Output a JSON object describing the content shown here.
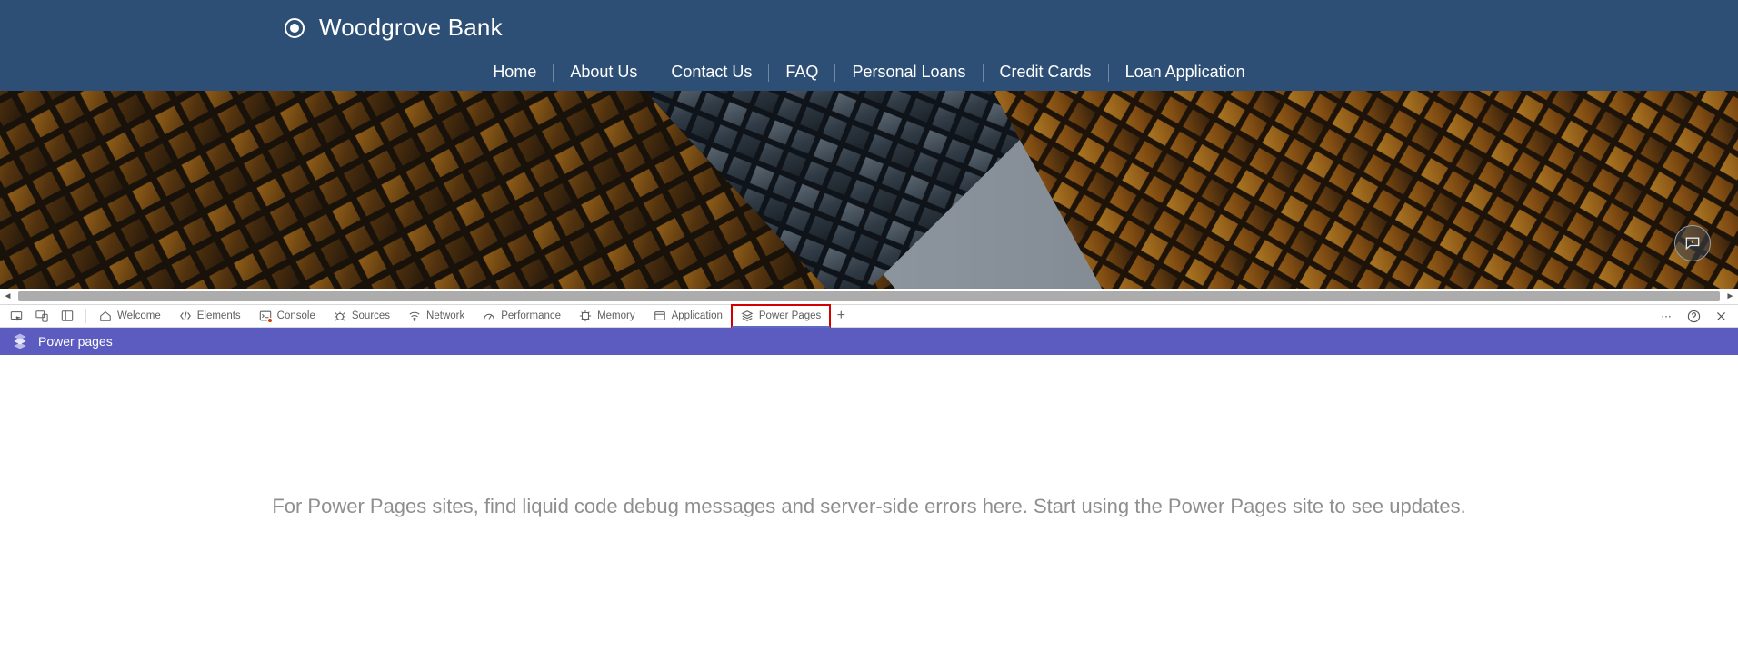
{
  "site": {
    "brand_name": "Woodgrove Bank",
    "nav": [
      "Home",
      "About Us",
      "Contact Us",
      "FAQ",
      "Personal Loans",
      "Credit Cards",
      "Loan Application"
    ]
  },
  "devtools": {
    "tabs": {
      "welcome": "Welcome",
      "elements": "Elements",
      "console": "Console",
      "sources": "Sources",
      "network": "Network",
      "performance": "Performance",
      "memory": "Memory",
      "application": "Application",
      "power_pages": "Power Pages"
    }
  },
  "panel": {
    "title": "Power pages",
    "message": "For Power Pages sites, find liquid code debug messages and server-side errors here. Start using the Power Pages site to see updates."
  }
}
